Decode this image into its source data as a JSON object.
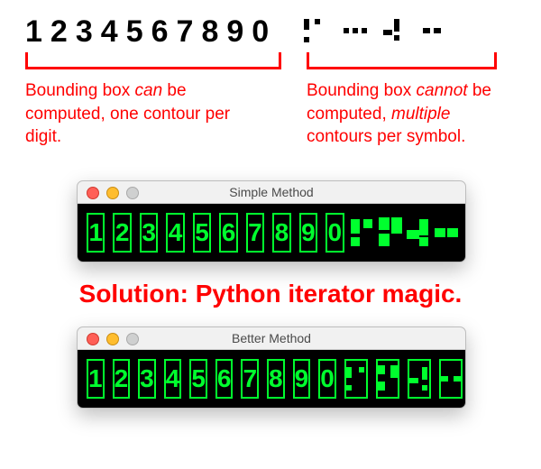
{
  "digits": [
    "1",
    "2",
    "3",
    "4",
    "5",
    "6",
    "7",
    "8",
    "9",
    "0"
  ],
  "captions": {
    "left_pre": "Bounding box ",
    "left_em": "can",
    "left_post": " be computed, one contour per digit.",
    "right_pre": "Bounding box ",
    "right_em1": "cannot",
    "right_mid": " be computed, ",
    "right_em2": "multiple",
    "right_post": " contours per symbol."
  },
  "windows": {
    "simple_title": "Simple Method",
    "better_title": "Better Method"
  },
  "solution": "Solution: Python iterator magic.",
  "colors": {
    "accent_red": "#f00",
    "led_green": "#00ff2e",
    "black": "#000"
  }
}
